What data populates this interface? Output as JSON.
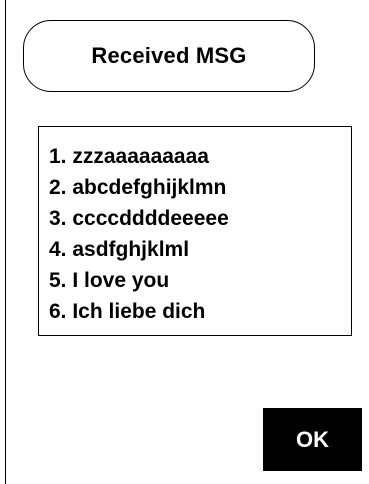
{
  "dialog": {
    "title": "Received MSG",
    "messages": [
      "1. zzzaaaaaaaaa",
      "2. abcdefghijklmn",
      "3. ccccddddeeeee",
      "4. asdfghjklml",
      "5. I love you",
      "6. Ich liebe dich"
    ],
    "ok_label": "OK"
  },
  "colors": {
    "background": "#ffffff",
    "foreground": "#000000",
    "button_background": "#000000",
    "button_text": "#ffffff"
  }
}
